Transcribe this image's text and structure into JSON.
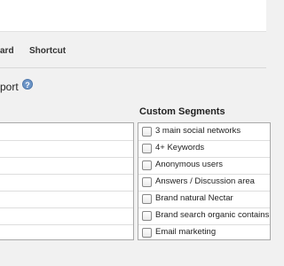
{
  "tabs": {
    "dashboard_partial": "ard",
    "shortcut": "Shortcut"
  },
  "page": {
    "title_partial": "port",
    "help_icon": "?"
  },
  "custom_segments": {
    "title": "Custom Segments",
    "items": [
      {
        "label": "3 main social networks",
        "checked": false
      },
      {
        "label": "4+ Keywords",
        "checked": false
      },
      {
        "label": "Anonymous users",
        "checked": false
      },
      {
        "label": "Answers / Discussion area",
        "checked": false
      },
      {
        "label": "Brand natural Nectar",
        "checked": false
      },
      {
        "label": "Brand search organic contains",
        "checked": false
      },
      {
        "label": "Email marketing",
        "checked": false
      }
    ]
  },
  "colors": {
    "help_icon": "#6c95c7",
    "background": "#f1f1f1",
    "panel": "#ffffff"
  }
}
